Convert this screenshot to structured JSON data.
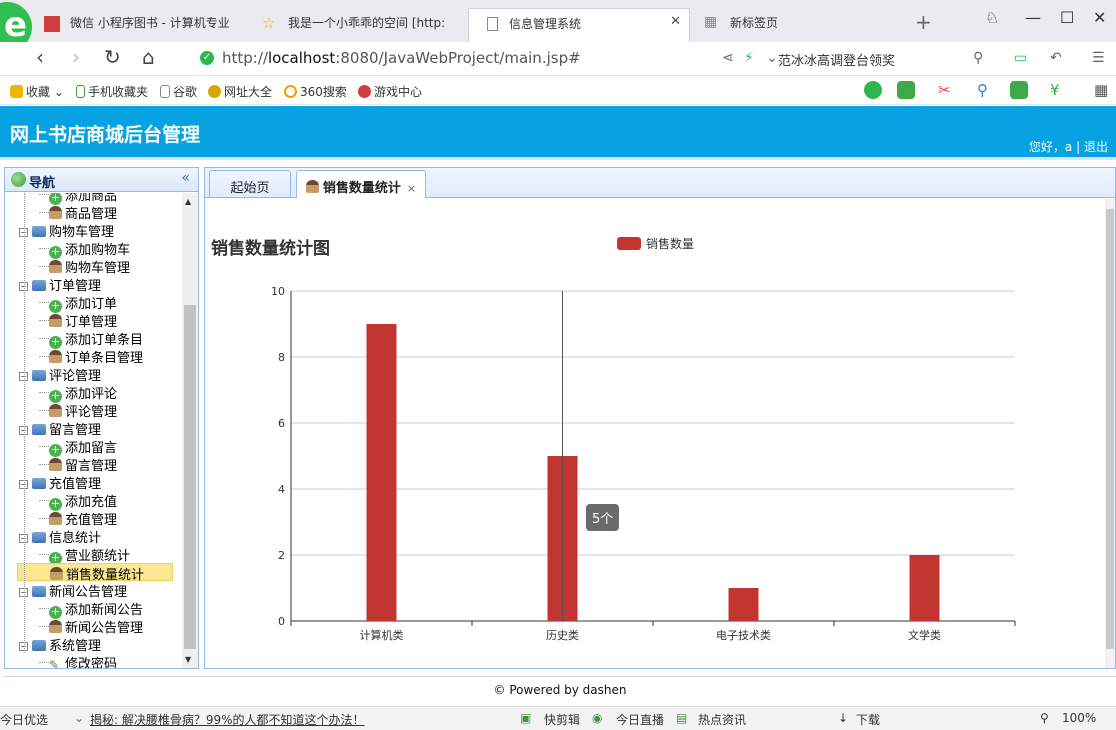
{
  "browser": {
    "tabs": [
      {
        "label": "微信 小程序图书 - 计算机专业",
        "icon": "wechat-icon"
      },
      {
        "label": "我是一个小乖乖的空间 [http:",
        "icon": "star-icon"
      },
      {
        "label": "信息管理系统",
        "icon": "page-icon"
      },
      {
        "label": "新标签页",
        "icon": "grid-icon"
      }
    ],
    "url_host": "localhost",
    "url_prefix": "http://",
    "url_rest": ":8080/JavaWebProject/main.jsp#",
    "search_hint": "范冰冰高调登台领奖",
    "bookmarks": [
      "收藏",
      "手机收藏夹",
      "谷歌",
      "网址大全",
      "360搜索",
      "游戏中心"
    ]
  },
  "app": {
    "title": "网上书店商城后台管理",
    "user_greeting": "您好，a",
    "separator": "|",
    "logout": "退出"
  },
  "sidebar": {
    "title": "导航",
    "collapse": "«",
    "nodes": [
      {
        "label": "添加商品",
        "type": "add",
        "level": 2
      },
      {
        "label": "商品管理",
        "type": "person",
        "level": 2
      },
      {
        "label": "购物车管理",
        "type": "folder",
        "level": 1
      },
      {
        "label": "添加购物车",
        "type": "add",
        "level": 2
      },
      {
        "label": "购物车管理",
        "type": "person",
        "level": 2
      },
      {
        "label": "订单管理",
        "type": "folder",
        "level": 1
      },
      {
        "label": "添加订单",
        "type": "add",
        "level": 2
      },
      {
        "label": "订单管理",
        "type": "person",
        "level": 2
      },
      {
        "label": "添加订单条目",
        "type": "add",
        "level": 2
      },
      {
        "label": "订单条目管理",
        "type": "person",
        "level": 2
      },
      {
        "label": "评论管理",
        "type": "folder",
        "level": 1
      },
      {
        "label": "添加评论",
        "type": "add",
        "level": 2
      },
      {
        "label": "评论管理",
        "type": "person",
        "level": 2
      },
      {
        "label": "留言管理",
        "type": "folder",
        "level": 1
      },
      {
        "label": "添加留言",
        "type": "add",
        "level": 2
      },
      {
        "label": "留言管理",
        "type": "person",
        "level": 2
      },
      {
        "label": "充值管理",
        "type": "folder",
        "level": 1
      },
      {
        "label": "添加充值",
        "type": "add",
        "level": 2
      },
      {
        "label": "充值管理",
        "type": "person",
        "level": 2
      },
      {
        "label": "信息统计",
        "type": "folder",
        "level": 1
      },
      {
        "label": "营业额统计",
        "type": "add",
        "level": 2
      },
      {
        "label": "销售数量统计",
        "type": "person",
        "level": 2,
        "selected": true
      },
      {
        "label": "新闻公告管理",
        "type": "folder",
        "level": 1
      },
      {
        "label": "添加新闻公告",
        "type": "add",
        "level": 2
      },
      {
        "label": "新闻公告管理",
        "type": "person",
        "level": 2
      },
      {
        "label": "系统管理",
        "type": "folder",
        "level": 1
      },
      {
        "label": "修改密码",
        "type": "pencil",
        "level": 2
      }
    ]
  },
  "panel_tabs": [
    {
      "label": "起始页"
    },
    {
      "label": "销售数量统计",
      "close": "×"
    }
  ],
  "chart_data": {
    "type": "bar",
    "title": "销售数量统计图",
    "categories": [
      "计算机类",
      "历史类",
      "电子技术类",
      "文学类"
    ],
    "series": [
      {
        "name": "销售数量",
        "values": [
          9,
          5,
          1,
          2
        ],
        "color": "#c23531"
      }
    ],
    "ylim": [
      0,
      10
    ],
    "yticks": [
      0,
      2,
      4,
      6,
      8,
      10
    ],
    "grid": true,
    "legend": "top-center",
    "tooltip": "5个"
  },
  "footer": "© Powered by dashen",
  "statusbar": {
    "left": "今日优选",
    "news": "揭秘: 解决腰椎骨病？99%的人都不知道这个办法！",
    "items": [
      "快剪辑",
      "今日直播",
      "热点资讯",
      "下载"
    ],
    "zoom": "100%"
  }
}
